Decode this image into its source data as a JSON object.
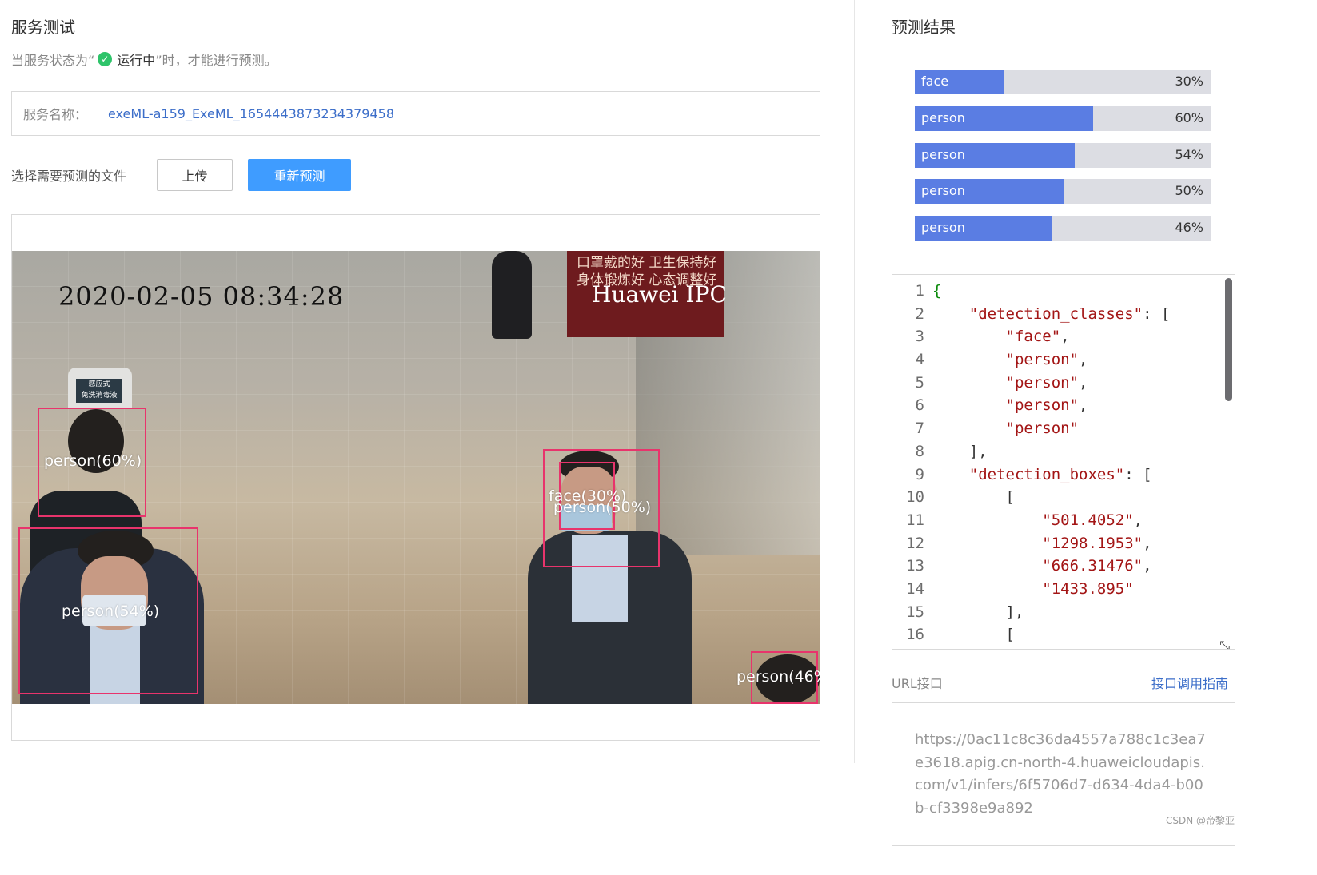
{
  "left": {
    "title": "服务测试",
    "hint_prefix": "当服务状态为“",
    "hint_status": "运行中",
    "hint_suffix": "”时，才能进行预测。",
    "service_name_label": "服务名称：",
    "service_name_value": "exeML-a159_ExeML_1654443873234379458",
    "select_file_label": "选择需要预测的文件",
    "upload_button": "上传",
    "repredict_button": "重新预测",
    "image": {
      "timestamp": "2020-02-05 08:34:28",
      "watermark": "Huawei IPC",
      "banner_text": "口罩戴的好 卫生保持好\n身体锻炼好 心态调整好",
      "sign_text": "感应式\n免洗消毒液",
      "detections": [
        {
          "label": "person(60%)"
        },
        {
          "label": "person(54%)"
        },
        {
          "label": "face(30%)"
        },
        {
          "label": "person(50%)"
        },
        {
          "label": "person(46%"
        }
      ]
    }
  },
  "right": {
    "title": "预测结果",
    "bars": [
      {
        "name": "face",
        "value": 30,
        "pct": "30%"
      },
      {
        "name": "person",
        "value": 60,
        "pct": "60%"
      },
      {
        "name": "person",
        "value": 54,
        "pct": "54%"
      },
      {
        "name": "person",
        "value": 50,
        "pct": "50%"
      },
      {
        "name": "person",
        "value": 46,
        "pct": "46%"
      }
    ],
    "code_lines": [
      {
        "n": "1",
        "t": "{"
      },
      {
        "n": "2",
        "t": "    \"detection_classes\": ["
      },
      {
        "n": "3",
        "t": "        \"face\","
      },
      {
        "n": "4",
        "t": "        \"person\","
      },
      {
        "n": "5",
        "t": "        \"person\","
      },
      {
        "n": "6",
        "t": "        \"person\","
      },
      {
        "n": "7",
        "t": "        \"person\""
      },
      {
        "n": "8",
        "t": "    ],"
      },
      {
        "n": "9",
        "t": "    \"detection_boxes\": ["
      },
      {
        "n": "10",
        "t": "        ["
      },
      {
        "n": "11",
        "t": "            \"501.4052\","
      },
      {
        "n": "12",
        "t": "            \"1298.1953\","
      },
      {
        "n": "13",
        "t": "            \"666.31476\","
      },
      {
        "n": "14",
        "t": "            \"1433.895\""
      },
      {
        "n": "15",
        "t": "        ],"
      },
      {
        "n": "16",
        "t": "        ["
      }
    ],
    "url_label": "URL接口",
    "url_guide": "接口调用指南",
    "url_value": "https://0ac11c8c36da4557a788c1c3ea7e3618.apig.cn-north-4.huaweicloudapis.com/v1/infers/6f5706d7-d634-4da4-b00b-cf3398e9a892"
  },
  "watermark_footer": "CSDN @帝黎亚",
  "colors": {
    "primary_button": "#3f9cff",
    "bar_fill": "#5a7de3",
    "bar_bg": "#dcdde3",
    "bbox": "#e8346c",
    "link": "#3c6ec9",
    "status_ok": "#2ec46a"
  }
}
